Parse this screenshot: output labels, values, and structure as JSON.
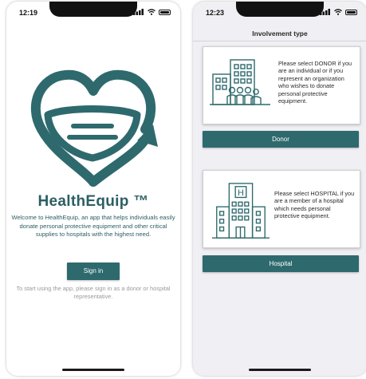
{
  "colors": {
    "brand_teal": "#2e6a6d",
    "text_teal": "#2c5f63",
    "hint_gray": "#9a9a9a",
    "button_text": "#ffffff"
  },
  "screen_welcome": {
    "status_time": "12:19",
    "app_title": "HealthEquip ™",
    "welcome_text": "Welcome to HealthEquip, an app that helps individuals easily donate personal protective equipment and other critical supplies to hospitals with the highest need.",
    "signin_label": "Sign in",
    "hint_text": "To start using the app, please sign in as a donor or hospital representative.",
    "icons": [
      "heart-mask-logo-icon",
      "cellular-signal-icon",
      "wifi-icon",
      "battery-icon"
    ]
  },
  "screen_involvement": {
    "status_time": "12:23",
    "nav_title": "Involvement type",
    "donor_card": {
      "description": "Please select DONOR if you are an individual or if you represent an organization who wishes to donate personal protective equipment.",
      "button_label": "Donor",
      "icon": "donor-group-building-icon"
    },
    "hospital_card": {
      "description": "Please select HOSPITAL if you are a member of a hospital which needs personal protective equipment.",
      "button_label": "Hospital",
      "icon": "hospital-building-icon",
      "icon_letter": "H"
    }
  }
}
